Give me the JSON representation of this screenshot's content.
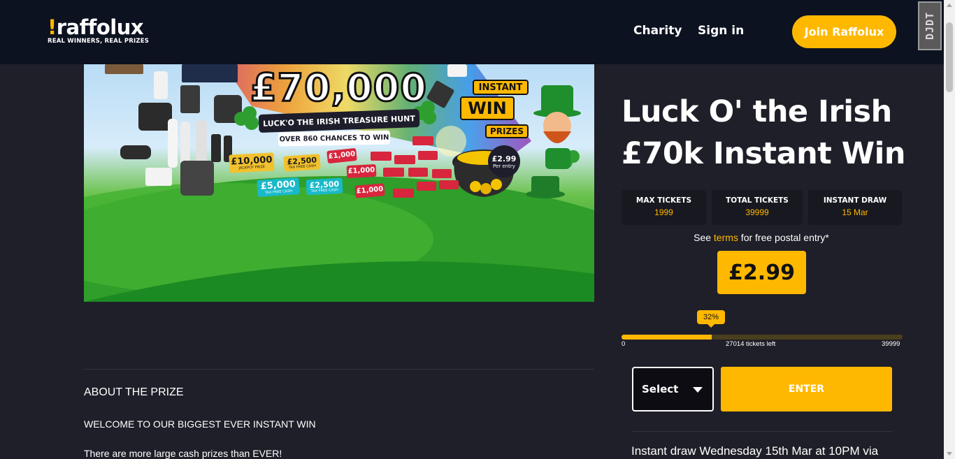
{
  "header": {
    "logo_text": "raffolux",
    "logo_tagline": "REAL WINNERS, REAL PRIZES",
    "nav": {
      "charity": "Charity",
      "sign_in": "Sign in"
    },
    "join_button": "Join Raffolux",
    "extension_badge": "DJDT"
  },
  "hero": {
    "headline": "£70,000",
    "banner_title": "LUCK'O THE IRISH TREASURE HUNT",
    "banner_sub": "OVER 860 CHANCES TO WIN",
    "instant_win": [
      "INSTANT",
      "WIN",
      "PRIZES"
    ],
    "price_badge": {
      "price": "£2.99",
      "per": "Per entry"
    },
    "prize_tags": [
      {
        "amount": "£10,000",
        "caption": "JACKPOT PRIZE"
      },
      {
        "amount": "£5,000",
        "caption": "TAX FREE CASH"
      },
      {
        "amount": "£2,500",
        "caption": "TAX FREE CASH"
      },
      {
        "amount": "£2,500",
        "caption": "TAX FREE CASH"
      },
      {
        "amount": "£1,000",
        "caption": ""
      },
      {
        "amount": "£1,000",
        "caption": ""
      },
      {
        "amount": "£1,000",
        "caption": ""
      }
    ]
  },
  "product": {
    "title_line1": "Luck O' the Irish",
    "title_line2": "£70k Instant Win",
    "stats": [
      {
        "label": "MAX TICKETS",
        "value": "1999"
      },
      {
        "label": "TOTAL TICKETS",
        "value": "39999"
      },
      {
        "label": "INSTANT DRAW",
        "value": "15 Mar"
      }
    ],
    "terms_prefix": "See ",
    "terms_link": "terms",
    "terms_suffix": " for free postal entry*",
    "price": "£2.99",
    "progress": {
      "percent_label": "32%",
      "fraction_sold": 0.32,
      "min_label": "0",
      "remaining_label": "27014 tickets left",
      "max_label": "39999"
    },
    "select_label": "Select",
    "enter_button": "ENTER",
    "draw_text": "Instant draw Wednesday 15th Mar at 10PM via"
  },
  "about": {
    "heading": "ABOUT THE PRIZE",
    "p1": "WELCOME TO OUR BIGGEST EVER INSTANT WIN",
    "p2": "There are more large cash prizes than EVER!"
  },
  "colors": {
    "accent": "#ffb800",
    "page_bg": "#1f1f29",
    "header_bg": "#0c1220"
  }
}
